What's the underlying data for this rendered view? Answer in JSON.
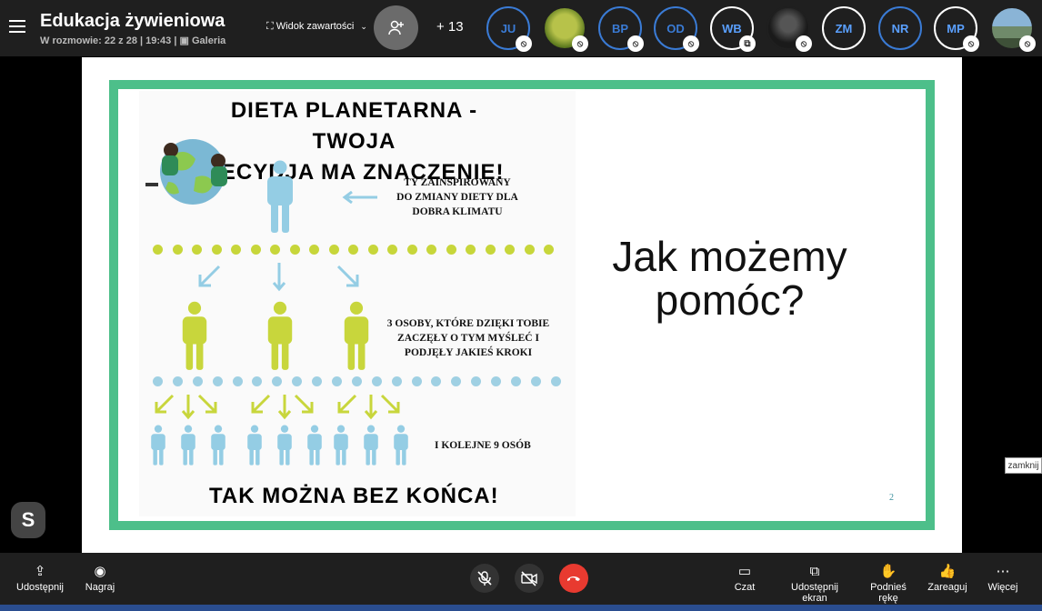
{
  "header": {
    "title": "Edukacja żywieniowa",
    "subtitle": "W rozmowie: 22 z 28  | 19:43 |",
    "gallery_label": "Galeria",
    "view_label": "Widok zawartości",
    "extra_count": "+ 13"
  },
  "participants": [
    {
      "initials": "JU",
      "style": "blue"
    },
    {
      "initials": "",
      "style": "shrek"
    },
    {
      "initials": "BP",
      "style": "blue"
    },
    {
      "initials": "OD",
      "style": "blue"
    },
    {
      "initials": "WB",
      "style": "white"
    },
    {
      "initials": "",
      "style": "person"
    },
    {
      "initials": "ZM",
      "style": "white"
    },
    {
      "initials": "NR",
      "style": "blue"
    },
    {
      "initials": "MP",
      "style": "white"
    },
    {
      "initials": "",
      "style": "land"
    }
  ],
  "slide": {
    "heading_line1": "DIETA PLANETARNA - TWOJA",
    "heading_line2": "DECYDJA MA ZNACZENIE!",
    "caption1": [
      "TY ZAINSPIROWANY",
      "DO ZMIANY DIETY DLA",
      "DOBRA KLIMATU"
    ],
    "caption2": [
      "3 OSOBY, KTÓRE DZIĘKI TOBIE",
      "ZACZĘŁY O TYM MYŚLEĆ I",
      "PODJĘŁY JAKIEŚ KROKI"
    ],
    "caption3": "I KOLEJNE 9 OSÓB",
    "footer": "TAK MOŻNA BEZ KOŃCA!",
    "right_line1": "Jak możemy",
    "right_line2": "pomóc?",
    "page_number": "2",
    "colors": {
      "green_border": "#4dbf8a",
      "lime": "#c7d63a",
      "light_blue": "#9fd0e3",
      "person_blue": "#94cde4",
      "person_lime": "#c8d63c"
    }
  },
  "tooltip": "zamknij",
  "toolbar": {
    "share": "Udostępnij",
    "record": "Nagraj",
    "chat": "Czat",
    "screen_share": "Udostępnij ekran",
    "raise_hand": "Podnieś rękę",
    "react": "Zareaguj",
    "more": "Więcej"
  }
}
